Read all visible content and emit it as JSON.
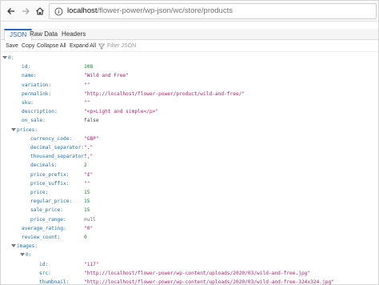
{
  "browser": {
    "url_host": "localhost",
    "url_path": "/flower-power/wp-json/wc/store/products"
  },
  "viewer": {
    "tabs": [
      "JSON",
      "Raw Data",
      "Headers"
    ],
    "actions": {
      "save": "Save",
      "copy": "Copy",
      "collapse_all": "Collapse All",
      "expand_all": "Expand All"
    },
    "filter_placeholder": "Filter JSON"
  },
  "tree": [
    {
      "depth": 0,
      "key": "0:",
      "expandable": true
    },
    {
      "depth": 1,
      "key": "id:",
      "value": "108",
      "type": "num"
    },
    {
      "depth": 1,
      "key": "name:",
      "value": "\"Wild and Free\"",
      "type": "str"
    },
    {
      "depth": 1,
      "key": "variation:",
      "value": "\"\"",
      "type": "str"
    },
    {
      "depth": 1,
      "key": "permalink:",
      "value": "\"http://localhost/flower-power/product/wild-and-free/\"",
      "type": "str"
    },
    {
      "depth": 1,
      "key": "sku:",
      "value": "\"\"",
      "type": "str"
    },
    {
      "depth": 1,
      "key": "description:",
      "value": "\"<p>Light and simple</p>\"",
      "type": "str"
    },
    {
      "depth": 1,
      "key": "on_sale:",
      "value": "false",
      "type": "bool"
    },
    {
      "depth": 1,
      "key": "prices:",
      "expandable": true
    },
    {
      "depth": 2,
      "key": "currency_code:",
      "value": "\"GBP\"",
      "type": "str"
    },
    {
      "depth": 2,
      "key": "decimal_separator:",
      "value": "\".\"",
      "type": "str"
    },
    {
      "depth": 2,
      "key": "thousand_separator:",
      "value": "\",\"",
      "type": "str"
    },
    {
      "depth": 2,
      "key": "decimals:",
      "value": "2",
      "type": "num"
    },
    {
      "depth": 2,
      "key": "price_prefix:",
      "value": "\"£\"",
      "type": "str"
    },
    {
      "depth": 2,
      "key": "price_suffix:",
      "value": "\"\"",
      "type": "str"
    },
    {
      "depth": 2,
      "key": "price:",
      "value": "15",
      "type": "num"
    },
    {
      "depth": 2,
      "key": "regular_price:",
      "value": "15",
      "type": "num"
    },
    {
      "depth": 2,
      "key": "sale_price:",
      "value": "15",
      "type": "num"
    },
    {
      "depth": 2,
      "key": "price_range:",
      "value": "null",
      "type": "null"
    },
    {
      "depth": 1,
      "key": "average_rating:",
      "value": "\"0\"",
      "type": "str"
    },
    {
      "depth": 1,
      "key": "review_count:",
      "value": "0",
      "type": "num"
    },
    {
      "depth": 1,
      "key": "images:",
      "expandable": true
    },
    {
      "depth": 2,
      "key": "0:",
      "expandable": true
    },
    {
      "depth": 3,
      "key": "id:",
      "value": "\"117\"",
      "type": "str"
    },
    {
      "depth": 3,
      "key": "src:",
      "value": "\"http://localhost/flower-power/wp-content/uploads/2020/03/wild-and-free.jpg\"",
      "type": "str"
    },
    {
      "depth": 3,
      "key": "thumbnail:",
      "value": "\"http://localhost/flower-power/wp-content/uploads/2020/03/wild-and-free-324x324.jpg\"",
      "type": "str"
    }
  ]
}
